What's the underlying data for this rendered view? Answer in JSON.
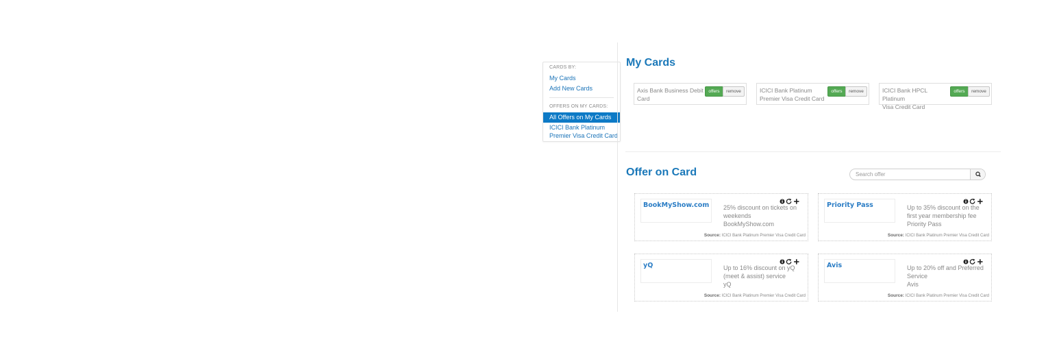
{
  "sidebar": {
    "cards_by_heading": "CARDS BY:",
    "links": [
      "My Cards",
      "Add New Cards"
    ],
    "offers_heading": "OFFERS ON MY CARDS:",
    "active_item": "All Offers on My Cards",
    "card_link_line1": "ICICI Bank Platinum",
    "card_link_line2": "Premier Visa Credit Card"
  },
  "my_cards": {
    "title": "My Cards",
    "offers_label": "offers",
    "remove_label": "remove",
    "cards": [
      {
        "line1": "Axis Bank Business Debit",
        "line2": "Card"
      },
      {
        "line1": "ICICI Bank Platinum",
        "line2": "Premier Visa Credit Card"
      },
      {
        "line1": "ICICI Bank HPCL Platinum",
        "line2": "Visa Credit Card"
      }
    ]
  },
  "offers_section": {
    "title": "Offer on Card",
    "search_placeholder": "Search offer",
    "source_label": "Source:",
    "source_value": "ICICI Bank Platinum Premier Visa Credit Card",
    "offers": [
      {
        "logo": "BookMyShow.com",
        "desc1": "25% discount on tickets on",
        "desc2": "weekends",
        "merchant": "BookMyShow.com"
      },
      {
        "logo": "Priority Pass",
        "desc1": "Up to 35% discount on the",
        "desc2": "first year membership fee",
        "merchant": "Priority Pass"
      },
      {
        "logo": "yQ",
        "desc1": "Up to 16% discount on yQ",
        "desc2": "(meet & assist) service",
        "merchant": "yQ"
      },
      {
        "logo": "Avis",
        "desc1": "Up to 20% off and Preferred",
        "desc2": "Service",
        "merchant": "Avis"
      }
    ]
  },
  "icons": [
    "info-icon",
    "share-icon",
    "plus-icon",
    "search-icon"
  ],
  "colors": {
    "accent": "#0d7ac6",
    "title": "#1a78b9",
    "offers_button": "#54a954"
  }
}
